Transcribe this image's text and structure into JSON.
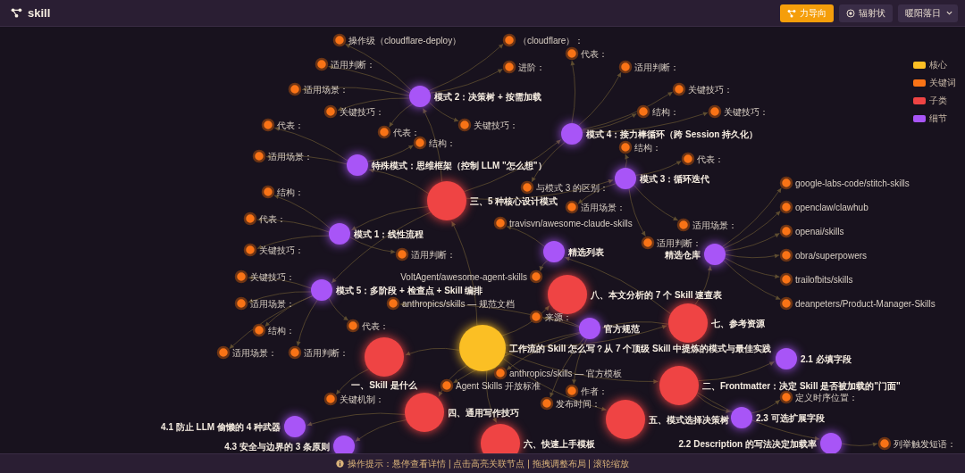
{
  "app": {
    "title": "skill"
  },
  "toolbar": {
    "layout_buttons": [
      {
        "label": "力导向",
        "kind": "force",
        "selected": true
      },
      {
        "label": "辐射状",
        "kind": "radial",
        "selected": false
      }
    ],
    "theme_select": {
      "value": "暖阳落日"
    }
  },
  "legend": [
    {
      "label": "核心",
      "kind": "core",
      "color": "#fbbf24"
    },
    {
      "label": "关键词",
      "kind": "keyword",
      "color": "#f97316"
    },
    {
      "label": "子类",
      "kind": "category",
      "color": "#ef4444"
    },
    {
      "label": "细节",
      "kind": "detail",
      "color": "#a855f7"
    }
  ],
  "graph": {
    "label": "工作流的 Skill 怎么写？从 7 个顶级 Skill 中提炼的模式与最佳实践",
    "kind": "core",
    "children": [
      {
        "label": "一、Skill 是什么",
        "kind": "category",
        "children": [
          {
            "label": "关键机制：",
            "kind": "keyword"
          }
        ]
      },
      {
        "label": "二、Frontmatter：决定 Skill 是否被加载的\"门面\"",
        "kind": "category",
        "children": [
          {
            "label": "2.1 必填字段",
            "kind": "detail"
          },
          {
            "label": "2.3 可选扩展字段",
            "kind": "detail",
            "children": [
              {
                "label": "定义时序位置：",
                "kind": "keyword"
              }
            ]
          },
          {
            "label": "2.2 Description 的写法决定加载率",
            "kind": "detail",
            "children": [
              {
                "label": "列举触发短语：",
                "kind": "keyword"
              }
            ]
          }
        ]
      },
      {
        "label": "三、5 种核心设计模式",
        "kind": "category",
        "children": [
          {
            "label": "模式 2：决策树 + 按需加载",
            "kind": "detail",
            "children": [
              {
                "label": "操作级（cloudflare-deploy）",
                "kind": "keyword"
              },
              {
                "label": "（cloudflare）：",
                "kind": "keyword"
              },
              {
                "label": "适用判断：",
                "kind": "keyword"
              },
              {
                "label": "进阶：",
                "kind": "keyword"
              },
              {
                "label": "适用场景：",
                "kind": "keyword"
              },
              {
                "label": "关键技巧：",
                "kind": "keyword"
              },
              {
                "label": "关键技巧：",
                "kind": "keyword"
              },
              {
                "label": "代表：",
                "kind": "keyword"
              }
            ]
          },
          {
            "label": "模式 4：接力棒循环（跨 Session 持久化）",
            "kind": "detail",
            "children": [
              {
                "label": "代表：",
                "kind": "keyword"
              },
              {
                "label": "适用判断：",
                "kind": "keyword"
              },
              {
                "label": "关键技巧：",
                "kind": "keyword"
              },
              {
                "label": "结构：",
                "kind": "keyword"
              },
              {
                "label": "关键技巧：",
                "kind": "keyword"
              },
              {
                "label": "与模式 3 的区别：",
                "kind": "keyword"
              }
            ]
          },
          {
            "label": "特殊模式：思维框架（控制 LLM \"怎么想\"）",
            "kind": "detail",
            "children": [
              {
                "label": "代表：",
                "kind": "keyword"
              },
              {
                "label": "适用场景：",
                "kind": "keyword"
              },
              {
                "label": "结构：",
                "kind": "keyword"
              }
            ]
          },
          {
            "label": "模式 3：循环迭代",
            "kind": "detail",
            "children": [
              {
                "label": "结构：",
                "kind": "keyword"
              },
              {
                "label": "代表：",
                "kind": "keyword"
              },
              {
                "label": "适用场景：",
                "kind": "keyword"
              },
              {
                "label": "适用判断：",
                "kind": "keyword"
              },
              {
                "label": "适用场景：",
                "kind": "keyword"
              }
            ]
          },
          {
            "label": "模式 1：线性流程",
            "kind": "detail",
            "children": [
              {
                "label": "结构：",
                "kind": "keyword"
              },
              {
                "label": "代表：",
                "kind": "keyword"
              },
              {
                "label": "关键技巧：",
                "kind": "keyword"
              },
              {
                "label": "适用判断：",
                "kind": "keyword"
              }
            ]
          },
          {
            "label": "模式 5：多阶段 + 检查点 + Skill 编排",
            "kind": "detail",
            "children": [
              {
                "label": "关键技巧：",
                "kind": "keyword"
              },
              {
                "label": "适用场景：",
                "kind": "keyword"
              },
              {
                "label": "结构：",
                "kind": "keyword"
              },
              {
                "label": "适用判断：",
                "kind": "keyword"
              },
              {
                "label": "代表：",
                "kind": "keyword"
              },
              {
                "label": "适用场景：",
                "kind": "keyword"
              }
            ]
          }
        ]
      },
      {
        "label": "四、通用写作技巧",
        "kind": "category",
        "children": [
          {
            "label": "4.1 防止 LLM 偷懒的 4 种武器",
            "kind": "detail"
          },
          {
            "label": "4.3 安全与边界的 3 条原则",
            "kind": "detail"
          }
        ]
      },
      {
        "label": "五、模式选择决策树",
        "kind": "category"
      },
      {
        "label": "六、快速上手模板",
        "kind": "category"
      },
      {
        "label": "七、参考资源",
        "kind": "category",
        "children": [
          {
            "label": "精选列表",
            "kind": "detail",
            "children": [
              {
                "label": "travisvn/awesome-claude-skills",
                "kind": "keyword"
              },
              {
                "label": "VoltAgent/awesome-agent-skills",
                "kind": "keyword"
              }
            ]
          },
          {
            "label": "精选仓库",
            "kind": "detail",
            "children": [
              {
                "label": "google-labs-code/stitch-skills",
                "kind": "keyword"
              },
              {
                "label": "openclaw/clawhub",
                "kind": "keyword"
              },
              {
                "label": "openai/skills",
                "kind": "keyword"
              },
              {
                "label": "obra/superpowers",
                "kind": "keyword"
              },
              {
                "label": "trailofbits/skills",
                "kind": "keyword"
              },
              {
                "label": "deanpeters/Product-Manager-Skills",
                "kind": "keyword"
              }
            ]
          },
          {
            "label": "官方规范",
            "kind": "detail",
            "children": [
              {
                "label": "anthropics/skills — 规范文档",
                "kind": "keyword"
              },
              {
                "label": "来源：",
                "kind": "keyword"
              },
              {
                "label": "anthropics/skills — 官方模板",
                "kind": "keyword"
              },
              {
                "label": "作者：",
                "kind": "keyword"
              },
              {
                "label": "Agent Skills 开放标准",
                "kind": "keyword"
              },
              {
                "label": "发布时间：",
                "kind": "keyword"
              }
            ]
          }
        ]
      },
      {
        "label": "八、本文分析的 7 个 Skill 速查表",
        "kind": "category"
      }
    ]
  },
  "footer": {
    "hint": "操作提示：悬停查看详情 | 点击高亮关联节点 | 拖拽调整布局 | 滚轮缩放"
  }
}
